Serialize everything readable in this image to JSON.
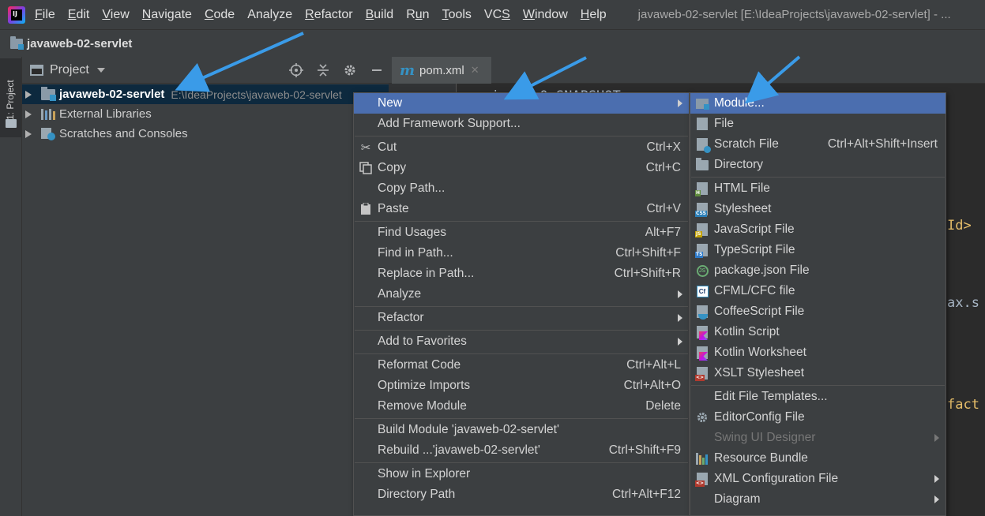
{
  "menubar": {
    "items": [
      {
        "label": "File",
        "u": 0
      },
      {
        "label": "Edit",
        "u": 0
      },
      {
        "label": "View",
        "u": 0
      },
      {
        "label": "Navigate",
        "u": 0
      },
      {
        "label": "Code",
        "u": 0
      },
      {
        "label": "Analyze",
        "u": -1
      },
      {
        "label": "Refactor",
        "u": 0
      },
      {
        "label": "Build",
        "u": 0
      },
      {
        "label": "Run",
        "u": 1
      },
      {
        "label": "Tools",
        "u": 0
      },
      {
        "label": "VCS",
        "u": 2
      },
      {
        "label": "Window",
        "u": 0
      },
      {
        "label": "Help",
        "u": 0
      }
    ],
    "window_title": "javaweb-02-servlet [E:\\IdeaProjects\\javaweb-02-servlet] - ..."
  },
  "navbar": {
    "project": "javaweb-02-servlet"
  },
  "tool_stripe": {
    "label": "1: Project"
  },
  "project_panel": {
    "title": "Project",
    "tree": [
      {
        "label": "javaweb-02-servlet",
        "path": "E:\\IdeaProjects\\javaweb-02-servlet",
        "icon": "module-folder-icon"
      },
      {
        "label": "External Libraries",
        "path": "",
        "icon": "library-icon"
      },
      {
        "label": "Scratches and Consoles",
        "path": "",
        "icon": "scratch-icon"
      }
    ]
  },
  "editor": {
    "tab": "pom.xml",
    "code_fragments": [
      {
        "text": "ion>1.0-SNAPSHOT",
        "color": "gray"
      },
      {
        "text": "Id>",
        "color": "orange"
      },
      {
        "text": "ax.s",
        "color": "gray"
      },
      {
        "text": "fact",
        "color": "orange"
      }
    ]
  },
  "context_menu": {
    "items": [
      {
        "label": "New",
        "shortcut": "",
        "submenu": true,
        "active": true,
        "icon": ""
      },
      {
        "label": "Add Framework Support...",
        "shortcut": "",
        "icon": ""
      },
      {
        "sep": true
      },
      {
        "label": "Cut",
        "shortcut": "Ctrl+X",
        "icon": "scissors-icon"
      },
      {
        "label": "Copy",
        "shortcut": "Ctrl+C",
        "icon": "copy-icon"
      },
      {
        "label": "Copy Path...",
        "shortcut": "",
        "icon": ""
      },
      {
        "label": "Paste",
        "shortcut": "Ctrl+V",
        "icon": "paste-icon"
      },
      {
        "sep": true
      },
      {
        "label": "Find Usages",
        "shortcut": "Alt+F7",
        "icon": ""
      },
      {
        "label": "Find in Path...",
        "shortcut": "Ctrl+Shift+F",
        "icon": ""
      },
      {
        "label": "Replace in Path...",
        "shortcut": "Ctrl+Shift+R",
        "icon": ""
      },
      {
        "label": "Analyze",
        "shortcut": "",
        "submenu": true,
        "icon": ""
      },
      {
        "sep": true
      },
      {
        "label": "Refactor",
        "shortcut": "",
        "submenu": true,
        "icon": ""
      },
      {
        "sep": true
      },
      {
        "label": "Add to Favorites",
        "shortcut": "",
        "submenu": true,
        "icon": ""
      },
      {
        "sep": true
      },
      {
        "label": "Reformat Code",
        "shortcut": "Ctrl+Alt+L",
        "icon": ""
      },
      {
        "label": "Optimize Imports",
        "shortcut": "Ctrl+Alt+O",
        "icon": ""
      },
      {
        "label": "Remove Module",
        "shortcut": "Delete",
        "icon": ""
      },
      {
        "sep": true
      },
      {
        "label": "Build Module 'javaweb-02-servlet'",
        "shortcut": "",
        "icon": ""
      },
      {
        "label": "Rebuild ...'javaweb-02-servlet'",
        "shortcut": "Ctrl+Shift+F9",
        "icon": ""
      },
      {
        "sep": true
      },
      {
        "label": "Show in Explorer",
        "shortcut": "",
        "icon": ""
      },
      {
        "label": "Directory Path",
        "shortcut": "Ctrl+Alt+F12",
        "icon": ""
      }
    ]
  },
  "new_submenu": {
    "items": [
      {
        "label": "Module...",
        "shortcut": "",
        "active": true,
        "icon": "module-icon"
      },
      {
        "label": "File",
        "shortcut": "",
        "icon": "file-icon"
      },
      {
        "label": "Scratch File",
        "shortcut": "Ctrl+Alt+Shift+Insert",
        "icon": "scratch-file-icon"
      },
      {
        "label": "Directory",
        "shortcut": "",
        "icon": "directory-icon"
      },
      {
        "sep": true
      },
      {
        "label": "HTML File",
        "shortcut": "",
        "icon": "html-file-icon",
        "tag": "H",
        "tagColor": "#5f8b3d"
      },
      {
        "label": "Stylesheet",
        "shortcut": "",
        "icon": "css-file-icon",
        "tag": "CSS",
        "tagColor": "#2c7fb8"
      },
      {
        "label": "JavaScript File",
        "shortcut": "",
        "icon": "js-file-icon",
        "tag": "JS",
        "tagColor": "#c2a000"
      },
      {
        "label": "TypeScript File",
        "shortcut": "",
        "icon": "ts-file-icon",
        "tag": "TS",
        "tagColor": "#2d79c7"
      },
      {
        "label": "package.json File",
        "shortcut": "",
        "icon": "nodejs-icon"
      },
      {
        "label": "CFML/CFC file",
        "shortcut": "",
        "icon": "cfml-icon"
      },
      {
        "label": "CoffeeScript File",
        "shortcut": "",
        "icon": "coffeescript-icon"
      },
      {
        "label": "Kotlin Script",
        "shortcut": "",
        "icon": "kotlin-icon"
      },
      {
        "label": "Kotlin Worksheet",
        "shortcut": "",
        "icon": "kotlin-worksheet-icon"
      },
      {
        "label": "XSLT Stylesheet",
        "shortcut": "",
        "icon": "xslt-icon",
        "tag": "<>",
        "tagColor": "#b03a2e"
      },
      {
        "sep": true
      },
      {
        "label": "Edit File Templates...",
        "shortcut": "",
        "icon": ""
      },
      {
        "label": "EditorConfig File",
        "shortcut": "",
        "icon": "gear-icon"
      },
      {
        "label": "Swing UI Designer",
        "shortcut": "",
        "submenu": true,
        "disabled": true,
        "icon": ""
      },
      {
        "label": "Resource Bundle",
        "shortcut": "",
        "icon": "resource-bundle-icon"
      },
      {
        "label": "XML Configuration File",
        "shortcut": "",
        "submenu": true,
        "icon": "xml-icon",
        "tag": "<>",
        "tagColor": "#b03a2e"
      },
      {
        "label": "Diagram",
        "shortcut": "",
        "submenu": true,
        "icon": ""
      }
    ]
  },
  "colors": {
    "menu_bg": "#3c3f41",
    "selection": "#4b6eaf",
    "tree_selection": "#0d293e",
    "annotation_arrow": "#3a9be8"
  }
}
